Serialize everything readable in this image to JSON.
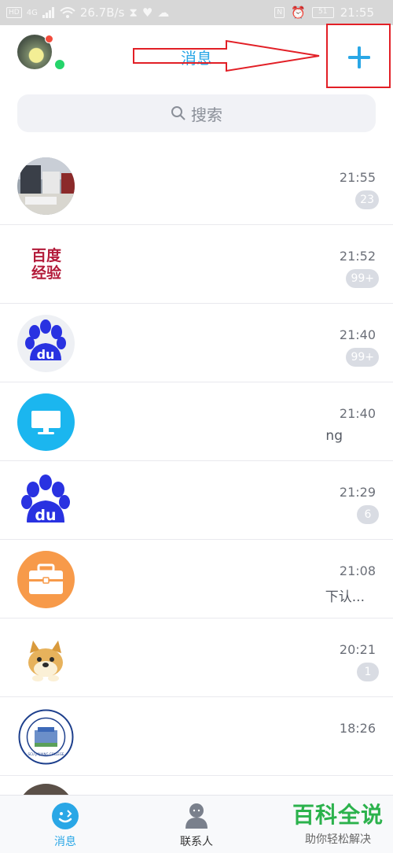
{
  "status_bar": {
    "hd_label": "HD",
    "signal_label": "4G",
    "speed": "26.7B/s",
    "nfc_label": "N",
    "battery_level": "51",
    "time": "21:55"
  },
  "header": {
    "title": "消息",
    "add_label": "+"
  },
  "search": {
    "placeholder": "搜索"
  },
  "conversations": [
    {
      "icon": "photo-avatar",
      "time": "21:55",
      "badge": "23",
      "snippet": ""
    },
    {
      "icon": "baidu-jingyan-logo",
      "time": "21:52",
      "badge": "99+",
      "snippet": ""
    },
    {
      "icon": "baidu-paw-logo",
      "time": "21:40",
      "badge": "99+",
      "snippet": ""
    },
    {
      "icon": "monitor-icon",
      "time": "21:40",
      "badge": "",
      "snippet": "ng"
    },
    {
      "icon": "baidu-paw-logo",
      "time": "21:29",
      "badge": "6",
      "snippet": ""
    },
    {
      "icon": "briefcase-icon",
      "time": "21:08",
      "badge": "",
      "snippet": "下认..."
    },
    {
      "icon": "doge-avatar",
      "time": "20:21",
      "badge": "1",
      "snippet": ""
    },
    {
      "icon": "college-logo",
      "time": "18:26",
      "badge": "",
      "snippet": ""
    }
  ],
  "college_logo_text": "SCU JINJIANG COLLEGE",
  "jingyan_logo_text": "百度经验",
  "bottom_nav": {
    "messages": "消息",
    "contacts": "联系人"
  },
  "watermark": {
    "title": "百科全说",
    "subtitle": "助你轻松解决"
  },
  "colors": {
    "accent": "#2aa7e6",
    "annotation": "#e21f26",
    "badge": "#d9dce3",
    "baidu_blue": "#2932e1"
  }
}
